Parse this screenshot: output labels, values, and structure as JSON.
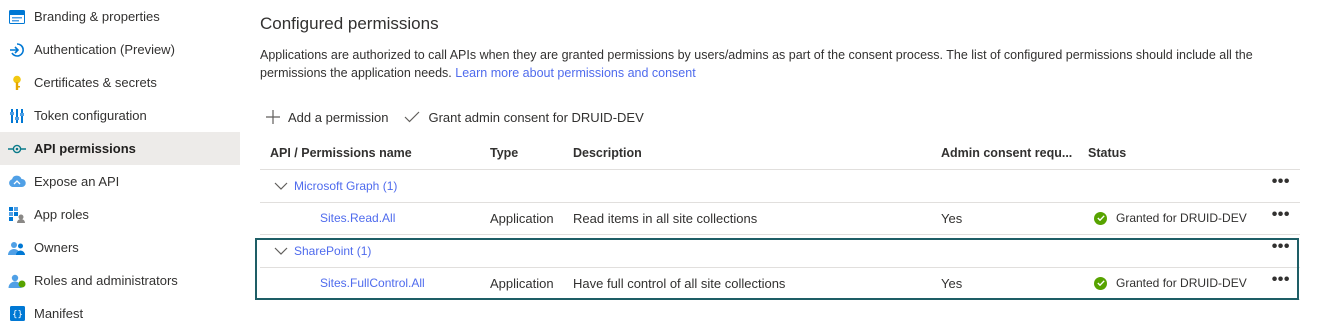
{
  "sidebar": {
    "items": [
      {
        "label": "Branding & properties",
        "icon": "branding-icon",
        "active": false
      },
      {
        "label": "Authentication (Preview)",
        "icon": "authentication-icon",
        "active": false
      },
      {
        "label": "Certificates & secrets",
        "icon": "key-icon",
        "active": false
      },
      {
        "label": "Token configuration",
        "icon": "token-icon",
        "active": false
      },
      {
        "label": "API permissions",
        "icon": "api-permissions-icon",
        "active": true
      },
      {
        "label": "Expose an API",
        "icon": "cloud-icon",
        "active": false
      },
      {
        "label": "App roles",
        "icon": "app-roles-icon",
        "active": false
      },
      {
        "label": "Owners",
        "icon": "owners-icon",
        "active": false
      },
      {
        "label": "Roles and administrators",
        "icon": "roles-icon",
        "active": false
      },
      {
        "label": "Manifest",
        "icon": "manifest-icon",
        "active": false
      }
    ]
  },
  "main": {
    "title": "Configured permissions",
    "description": "Applications are authorized to call APIs when they are granted permissions by users/admins as part of the consent process. The list of configured permissions should include all the permissions the application needs.",
    "learn_more": "Learn more about permissions and consent",
    "toolbar": {
      "add_label": "Add a permission",
      "grant_label": "Grant admin consent for DRUID-DEV"
    },
    "table": {
      "headers": {
        "api": "API / Permissions name",
        "type": "Type",
        "description": "Description",
        "admin": "Admin consent requ...",
        "status": "Status"
      },
      "groups": [
        {
          "name": "Microsoft Graph (1)",
          "permission": {
            "name": "Sites.Read.All",
            "type": "Application",
            "description": "Read items in all site collections",
            "admin": "Yes",
            "status": "Granted for DRUID-DEV"
          }
        },
        {
          "name": "SharePoint (1)",
          "permission": {
            "name": "Sites.FullControl.All",
            "type": "Application",
            "description": "Have full control of all site collections",
            "admin": "Yes",
            "status": "Granted for DRUID-DEV"
          }
        }
      ],
      "more_label": "•••"
    }
  },
  "colors": {
    "link": "#4f6bed",
    "active_bg": "#edebe9",
    "granted": "#57a300",
    "highlight_border": "#1e5e66"
  }
}
